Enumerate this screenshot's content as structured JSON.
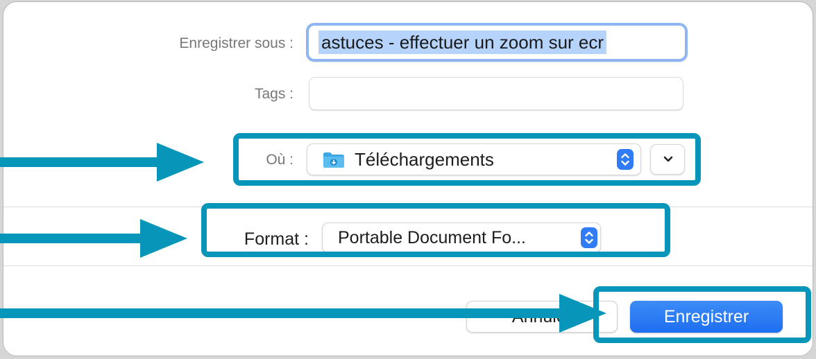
{
  "dialog": {
    "save_as_label": "Enregistrer sous :",
    "save_as_value": "astuces - effectuer un zoom sur ecr",
    "tags_label": "Tags :",
    "tags_value": "",
    "where_label": "Où :",
    "where_value": "Téléchargements",
    "where_icon": "downloads-folder-icon",
    "format_label": "Format :",
    "format_value": "Portable Document Fo...",
    "cancel_label": "Annuler",
    "save_label": "Enregistrer"
  },
  "annotations": {
    "highlight_color": "#0795b9",
    "arrow_color": "#0795b9",
    "highlights": [
      "where-row",
      "format-row",
      "save-button"
    ]
  },
  "colors": {
    "accent": "#2f7cf6",
    "selection": "#b5d3fb",
    "focus_ring": "#8fb5f2"
  }
}
